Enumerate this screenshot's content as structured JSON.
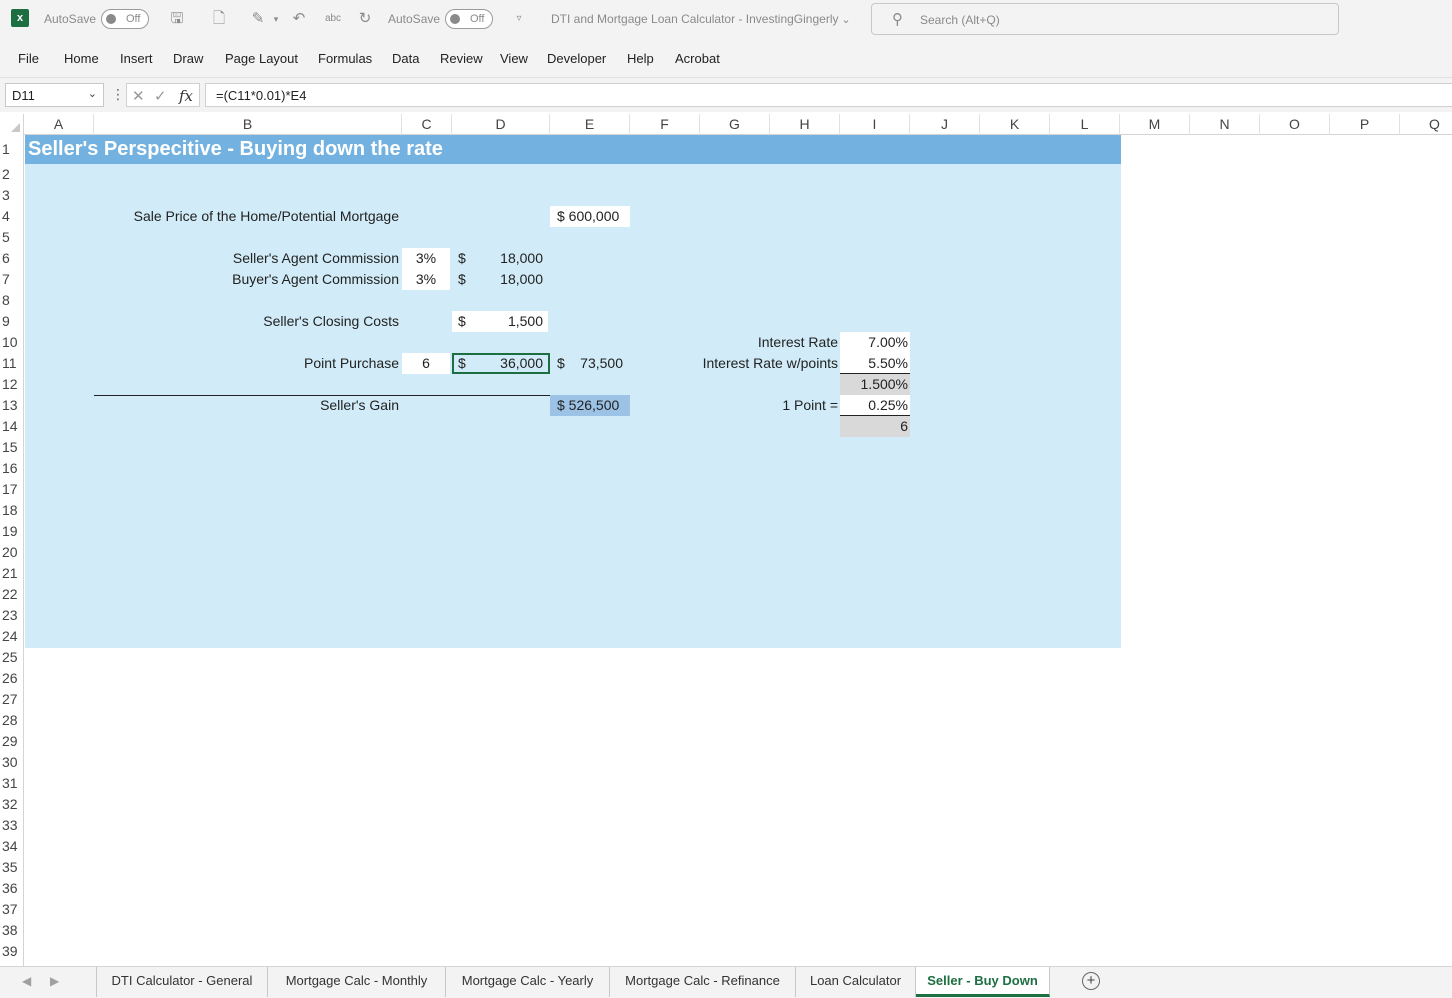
{
  "app": {
    "logo_letter": "x",
    "autosave_label": "AutoSave",
    "autosave_state": "Off",
    "autosave_label_2": "AutoSave",
    "autosave_state_2": "Off",
    "doc_title": "DTI and Mortgage Loan Calculator - InvestingGingerly",
    "search_placeholder": "Search (Alt+Q)"
  },
  "menu": [
    "File",
    "Home",
    "Insert",
    "Draw",
    "Page Layout",
    "Formulas",
    "Data",
    "Review",
    "View",
    "Developer",
    "Help",
    "Acrobat"
  ],
  "formula_bar": {
    "name_box": "D11",
    "formula": "=(C11*0.01)*E4",
    "fx": "fx"
  },
  "columns": [
    "A",
    "B",
    "C",
    "D",
    "E",
    "F",
    "G",
    "H",
    "I",
    "J",
    "K",
    "L",
    "M",
    "N",
    "O",
    "P",
    "Q"
  ],
  "rows": [
    "1",
    "2",
    "3",
    "4",
    "5",
    "6",
    "7",
    "8",
    "9",
    "10",
    "11",
    "12",
    "13",
    "14",
    "15",
    "16",
    "17",
    "18",
    "19",
    "20",
    "21",
    "22",
    "23",
    "24",
    "25",
    "26",
    "27",
    "28",
    "29",
    "30",
    "31",
    "32",
    "33",
    "34",
    "35",
    "36",
    "37",
    "38",
    "39"
  ],
  "sheet": {
    "title": "Seller's Perspecitive - Buying down the rate",
    "sale_price_label": "Sale Price of the Home/Potential Mortgage",
    "sale_price_value": "$ 600,000",
    "seller_agent_label": "Seller's Agent Commission",
    "seller_agent_pct": "3%",
    "seller_agent_cur": "$",
    "seller_agent_amt": "18,000",
    "buyer_agent_label": "Buyer's Agent Commission",
    "buyer_agent_pct": "3%",
    "buyer_agent_cur": "$",
    "buyer_agent_amt": "18,000",
    "closing_label": "Seller's Closing Costs",
    "closing_cur": "$",
    "closing_amt": "1,500",
    "points_label": "Point Purchase",
    "points_count": "6",
    "points_cur": "$",
    "points_amt": "36,000",
    "total_cur": "$",
    "total_amt": "73,500",
    "gain_label": "Seller's Gain",
    "gain_value": "$ 526,500",
    "interest_label": "Interest Rate",
    "interest_value": "7.00%",
    "interest_points_label": "Interest Rate w/points",
    "interest_points_value": "5.50%",
    "rate_diff": "1.500%",
    "one_point_label": "1 Point =",
    "one_point_value": "0.25%",
    "points_needed": "6"
  },
  "tabs": [
    "DTI Calculator - General",
    "Mortgage Calc - Monthly",
    "Mortgage Calc - Yearly",
    "Mortgage Calc - Refinance",
    "Loan Calculator",
    "Seller - Buy Down"
  ],
  "active_tab": "Seller - Buy Down",
  "colors": {
    "banner": "#73b2e0",
    "panel": "#d1ecf8",
    "excel_green": "#1d6f42"
  }
}
